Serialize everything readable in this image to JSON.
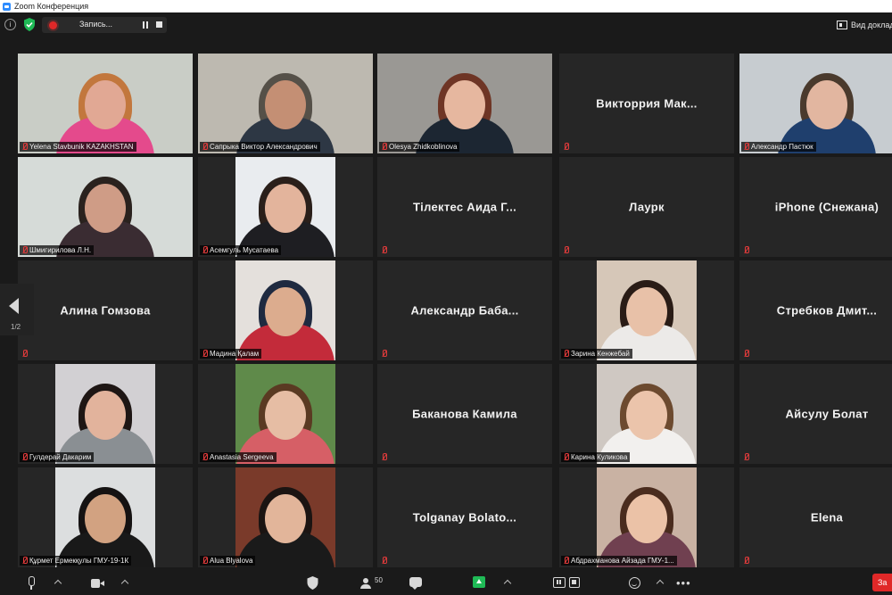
{
  "window": {
    "title": "Zoom Конференция"
  },
  "topbar": {
    "info_icon": "i",
    "recording_label": "Запись...",
    "view_label": "Вид докладчика"
  },
  "tiles": [
    {
      "kind": "video",
      "label": "Yelena Stavbunik KAZAKHSTAN",
      "bg": "#c9cdc6",
      "skin": "#e1a894",
      "hair": "#c2773d",
      "shirt": "#e44a8c"
    },
    {
      "kind": "video",
      "label": "Сапрыка Виктор Александрович",
      "bg": "#bdb9b0",
      "skin": "#c48f74",
      "hair": "#555048",
      "shirt": "#2d3744"
    },
    {
      "kind": "video",
      "label": "Olesya Zhidkoblinova",
      "bg": "#9a9894",
      "skin": "#e6b79f",
      "hair": "#6e3525",
      "shirt": "#1c2632",
      "active": true
    },
    {
      "kind": "name",
      "name": "Викторрия Мак...",
      "label": ""
    },
    {
      "kind": "video",
      "label": "Александр Пастюк",
      "bg": "#c7ccd0",
      "skin": "#e2b6a0",
      "hair": "#4a3a2d",
      "shirt": "#1f3f6d"
    },
    {
      "kind": "video",
      "label": "Шмигирилова Л.Н.",
      "bg": "#d6dbd8",
      "skin": "#cf9c86",
      "hair": "#2a221e",
      "shirt": "#3a2c32"
    },
    {
      "kind": "video",
      "label": "Асемгуль Мусатаева",
      "bg": "#e9ecef",
      "skin": "#e3b49c",
      "hair": "#2a1f1a",
      "shirt": "#1e1e22"
    },
    {
      "kind": "name",
      "name": "Тілектес Аида Г...",
      "label": ""
    },
    {
      "kind": "name",
      "name": "Лаурк",
      "label": ""
    },
    {
      "kind": "name",
      "name": "iPhone (Снежана)",
      "label": ""
    },
    {
      "kind": "name",
      "name": "Алина Гомзова",
      "label": ""
    },
    {
      "kind": "video",
      "label": "Мадина Қалам",
      "bg": "#e4e0dc",
      "skin": "#dcac8e",
      "hair": "#1f2a40",
      "shirt": "#c32b3a"
    },
    {
      "kind": "name",
      "name": "Александр Баба...",
      "label": ""
    },
    {
      "kind": "video",
      "label": "Зарина Кенжебай",
      "bg": "#d6c7b8",
      "skin": "#e8c1a8",
      "hair": "#2a1c16",
      "shirt": "#eceae8"
    },
    {
      "kind": "name",
      "name": "Стребков Дмит...",
      "label": ""
    },
    {
      "kind": "video",
      "label": "Гулдерай Дакарим",
      "bg": "#d2d0d3",
      "skin": "#e2b39c",
      "hair": "#1e1614",
      "shirt": "#8a8f93"
    },
    {
      "kind": "video",
      "label": "Anastasia Sergeeva",
      "bg": "#5f8a4a",
      "skin": "#e6bda4",
      "hair": "#5a3a22",
      "shirt": "#d65f66"
    },
    {
      "kind": "name",
      "name": "Баканова Камила",
      "label": ""
    },
    {
      "kind": "video",
      "label": "Карина Куликова",
      "bg": "#cfc8c2",
      "skin": "#ebc4ab",
      "hair": "#6c4a2f",
      "shirt": "#f2f0ee"
    },
    {
      "kind": "name",
      "name": "Айсулу Болат",
      "label": ""
    },
    {
      "kind": "video",
      "label": "Құрмет Ермекқулы ГМУ-19-1К",
      "bg": "#dcdedf",
      "skin": "#d2a281",
      "hair": "#151212",
      "shirt": "#191919"
    },
    {
      "kind": "video",
      "label": "Alua Blyalova",
      "bg": "#7a3a2a",
      "skin": "#e2b59a",
      "hair": "#1b1412",
      "shirt": "#1a1a1a"
    },
    {
      "kind": "name",
      "name": "Tolganay Bolato...",
      "label": ""
    },
    {
      "kind": "video",
      "label": "Абдрахманова Айзада ГМУ-1...",
      "bg": "#c9b2a3",
      "skin": "#ebc2a7",
      "hair": "#4a2c1e",
      "shirt": "#704050"
    },
    {
      "kind": "name",
      "name": "Elena",
      "label": ""
    }
  ],
  "nav": {
    "page": "1/2"
  },
  "bottombar": {
    "participants_count": "50",
    "more_label": "•••",
    "end_label": "За"
  },
  "colors": {
    "active_border": "#b6d84a",
    "muted_red": "#e23b3b",
    "record_red": "#e02828",
    "share_green": "#1fba56"
  }
}
